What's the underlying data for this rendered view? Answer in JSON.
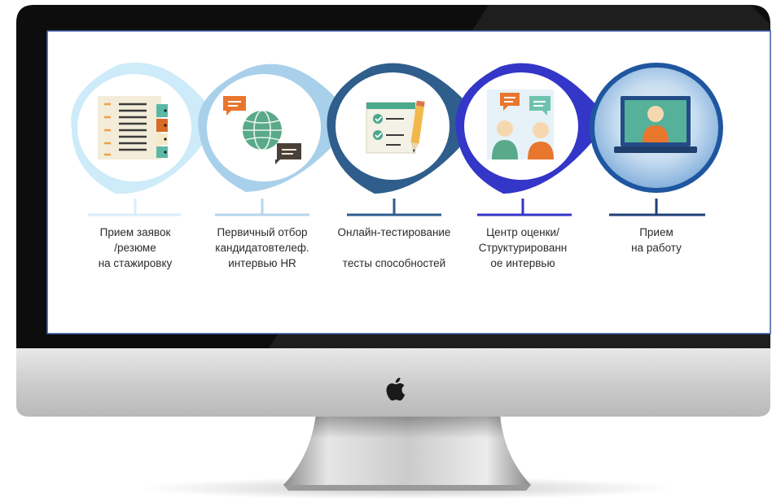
{
  "brand": {
    "name": "Apple",
    "icon": "apple-logo"
  },
  "colors": {
    "screen_background": "#ffffff",
    "stage_1": "#cdebf8",
    "stage_2": "#a9d0ea",
    "stage_3": "#2f5d8c",
    "stage_4": "#3436c8",
    "stage_5": "#1f56a0",
    "final_disc": "#86b7e2"
  },
  "stages": [
    {
      "id": "applications",
      "icon": "resume-list-icon",
      "label": "Прием заявок\n/резюме\nна стажировку"
    },
    {
      "id": "screening",
      "icon": "globe-chat-icon",
      "label": "Первичный отбор\nкандидатовтелеф.\nинтервью HR"
    },
    {
      "id": "testing",
      "icon": "checklist-pencil-icon",
      "label": "Онлайн-тестирование\n\nтесты способностей"
    },
    {
      "id": "assessment",
      "icon": "people-dialogue-icon",
      "label": "Центр оценки/\nСтруктурированн\nое интервью"
    },
    {
      "id": "hiring",
      "icon": "video-call-person-icon",
      "label": "Прием\nна работу"
    }
  ]
}
